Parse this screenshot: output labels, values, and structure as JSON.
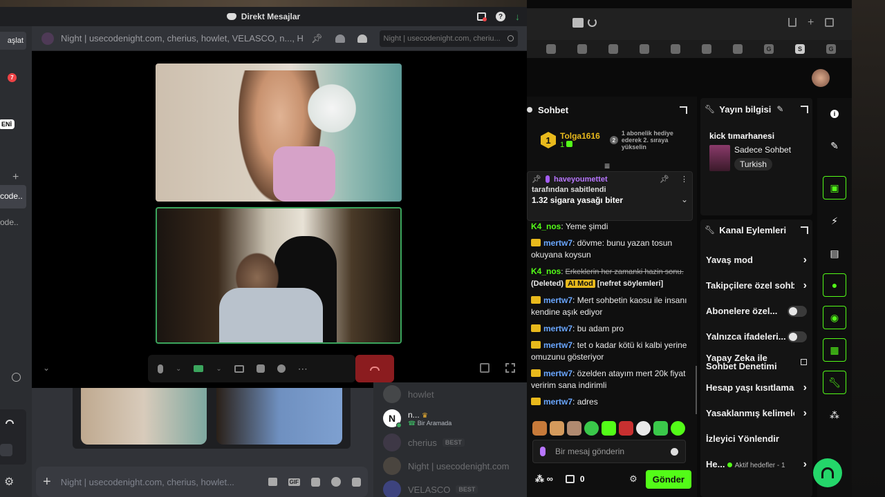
{
  "discord": {
    "window_title": "Direkt Mesajlar",
    "left_peek": {
      "start_label": "aşlat",
      "badge_count": "7",
      "new_badge": "ENİ",
      "item1": "code..",
      "item2": "ode.."
    },
    "channel_header": "Night | usecodenight.com, cherius, howlet, VELASCO, n..., Hu",
    "search_placeholder": "Night | usecodenight.com, cheriu...",
    "members": [
      {
        "name": "howlet",
        "status": ""
      },
      {
        "name": "n...",
        "status": "Bir Aramada"
      },
      {
        "name": "cherius",
        "status": "",
        "badge": "BEST"
      },
      {
        "name": "Night | usecodenight.com",
        "status": ""
      },
      {
        "name": "VELASCO",
        "status": "",
        "badge": "BEST"
      }
    ],
    "message_placeholder": "Night | usecodenight.com, cherius, howlet..."
  },
  "kick": {
    "chat": {
      "title": "Sohbet",
      "leader": {
        "name": "Tolga1616",
        "rank": "1",
        "count": "1",
        "gift_rank": "2",
        "gift_text": "1 abonelik hediye ederek 2. sıraya yükselin"
      },
      "pinned": {
        "user": "haveyoumettet",
        "by": "tarafından sabitlendi",
        "text": "1.32 sigara yasağı biter"
      },
      "messages": [
        {
          "user": "K4_nos",
          "text": "Yeme şimdi",
          "sub": false,
          "deleted": false
        },
        {
          "user": "mertw7",
          "text": "dövme: bunu yazan tosun okuyana koysun",
          "sub": true,
          "deleted": false
        },
        {
          "user": "K4_nos",
          "text": "Erkeklerin her zamanki hazin sonu.",
          "sub": false,
          "deleted": true,
          "deleted_label": "(Deleted)",
          "mod_label": "AI Mod",
          "reason": "[nefret söylemleri]"
        },
        {
          "user": "mertw7",
          "text": "Mert sohbetin kaosu ile insanı kendine aşık ediyor",
          "sub": true,
          "deleted": false
        },
        {
          "user": "mertw7",
          "text": "bu adam pro",
          "sub": true,
          "deleted": false
        },
        {
          "user": "mertw7",
          "text": "tet o kadar kötü ki kalbi yerine omuzunu gösteriyor",
          "sub": true,
          "deleted": false
        },
        {
          "user": "mertw7",
          "text": "özelden atayım mert 20k fiyat veririm sana indirimli",
          "sub": true,
          "deleted": false
        },
        {
          "user": "mertw7",
          "text": "adres",
          "sub": true,
          "deleted": false
        }
      ],
      "input_placeholder": "Bir mesaj gönderin",
      "points": "0",
      "send_label": "Gönder"
    },
    "stream_info": {
      "title": "Yayın bilgisi",
      "stream_title": "kick tımarhanesi",
      "category": "Sadece Sohbet",
      "language": "Turkish"
    },
    "channel_actions": {
      "title": "Kanal Eylemleri",
      "items": [
        {
          "label": "Yavaş mod",
          "control": "chevron"
        },
        {
          "label": "Takipçilere özel sohbet",
          "control": "chevron"
        },
        {
          "label": "Abonelere özel...",
          "control": "toggle"
        },
        {
          "label": "Yalnızca ifadeleri...",
          "control": "toggle"
        },
        {
          "label": "Yapay Zeka ile Sohbet Denetimi",
          "control": "external"
        },
        {
          "label": "Hesap yaşı kısıtlaması",
          "control": "chevron"
        },
        {
          "label": "Yasaklanmış kelimeler",
          "control": "chevron"
        },
        {
          "label": "İzleyici Yönlendir",
          "control": "none"
        },
        {
          "label": "He...",
          "control": "chevron",
          "extra": "Aktif hedefler - 1"
        }
      ]
    }
  },
  "colors": {
    "kick_green": "#53fc18",
    "discord_bg": "#313338",
    "crown": "#e8b91c"
  }
}
